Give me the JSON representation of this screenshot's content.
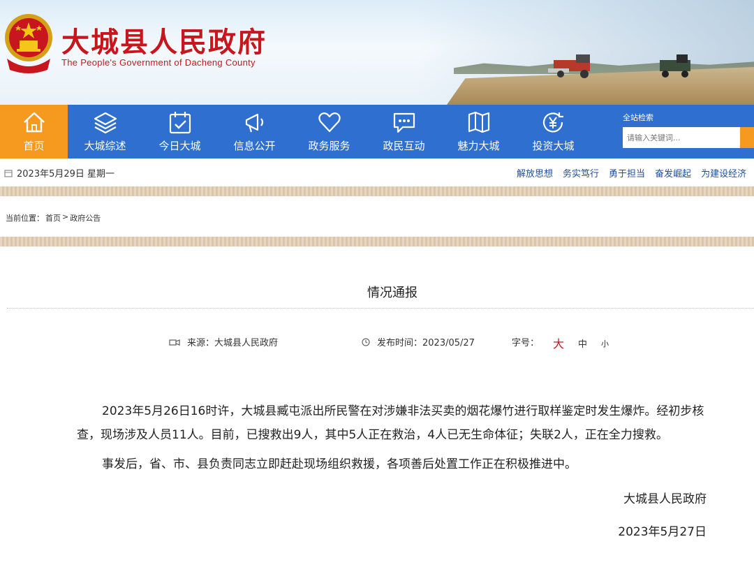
{
  "banner": {
    "title_cn": "大城县人民政府",
    "title_en": "The People's Government of Dacheng County"
  },
  "nav": {
    "items": [
      {
        "label": "首页",
        "icon": "home-icon",
        "active": true
      },
      {
        "label": "大城综述",
        "icon": "layers-icon",
        "active": false
      },
      {
        "label": "今日大城",
        "icon": "calendar-check-icon",
        "active": false
      },
      {
        "label": "信息公开",
        "icon": "megaphone-icon",
        "active": false
      },
      {
        "label": "政务服务",
        "icon": "heart-icon",
        "active": false
      },
      {
        "label": "政民互动",
        "icon": "chat-bubble-icon",
        "active": false
      },
      {
        "label": "魅力大城",
        "icon": "map-icon",
        "active": false
      },
      {
        "label": "投资大城",
        "icon": "yuan-icon",
        "active": false
      }
    ],
    "active_color": "#f59a1f",
    "bar_color": "#2e6fcf"
  },
  "search": {
    "title": "全站检索",
    "placeholder": "请输入关键词..."
  },
  "datebar": {
    "date": "2023年5月29日 星期一",
    "slogans": [
      "解放思想",
      "务实笃行",
      "勇于担当",
      "奋发崛起",
      "为建设经济"
    ]
  },
  "breadcrumb": {
    "prefix": "当前位置：",
    "home": "首页",
    "separator": ">",
    "current": "政府公告"
  },
  "article": {
    "title": "情况通报",
    "source": "来源：大城县人民政府",
    "publish_time": "发布时间：2023/05/27",
    "font_size_label": "字号：",
    "font_sizes": {
      "large": "大",
      "medium": "中",
      "small": "小"
    },
    "paragraphs": [
      "2023年5月26日16时许，大城县臧屯派出所民警在对涉嫌非法买卖的烟花爆竹进行取样鉴定时发生爆炸。经初步核查，现场涉及人员11人。目前，已搜救出9人，其中5人正在救治，4人已无生命体征；失联2人，正在全力搜救。",
      "事发后，省、市、县负责同志立即赶赴现场组织救援，各项善后处置工作正在积极推进中。"
    ],
    "signature": "大城县人民政府",
    "sign_date": "2023年5月27日"
  }
}
